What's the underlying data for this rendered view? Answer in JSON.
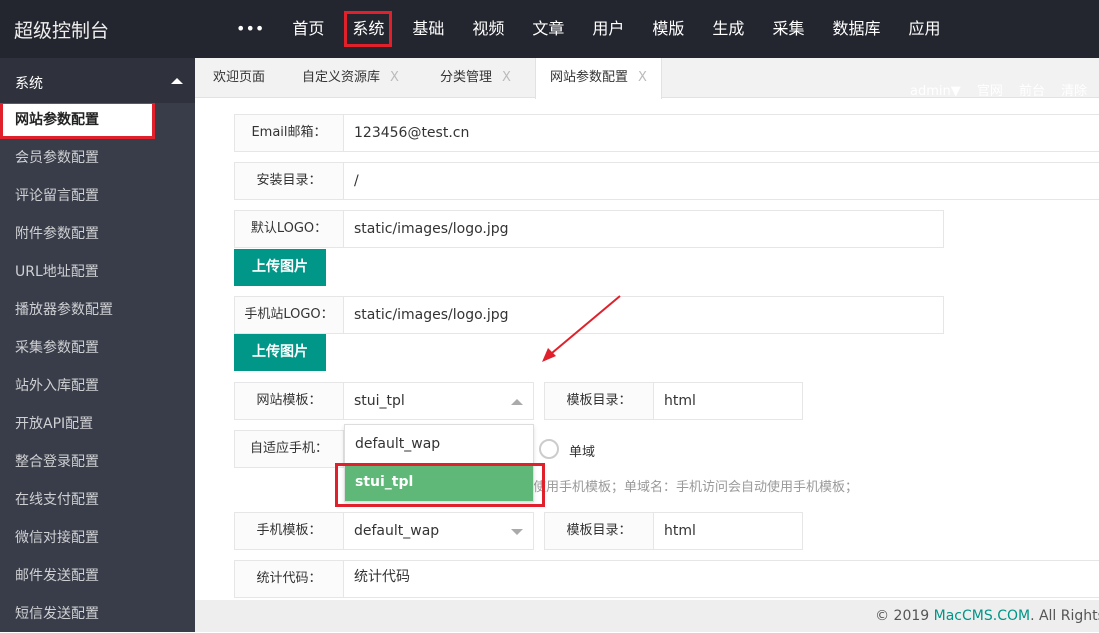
{
  "header": {
    "title": "超级控制台",
    "more": "•••",
    "nav": [
      "首页",
      "系统",
      "基础",
      "视频",
      "文章",
      "用户",
      "模版",
      "生成",
      "采集",
      "数据库",
      "应用"
    ],
    "active": "系统"
  },
  "sidebar": {
    "section": "系统",
    "items": [
      "网站参数配置",
      "会员参数配置",
      "评论留言配置",
      "附件参数配置",
      "URL地址配置",
      "播放器参数配置",
      "采集参数配置",
      "站外入库配置",
      "开放API配置",
      "整合登录配置",
      "在线支付配置",
      "微信对接配置",
      "邮件发送配置",
      "短信发送配置"
    ]
  },
  "tabs": [
    {
      "label": "欢迎页面"
    },
    {
      "label": "自定义资源库",
      "close": "X"
    },
    {
      "label": "分类管理",
      "close": "X"
    },
    {
      "label": "网站参数配置",
      "close": "X"
    }
  ],
  "top_links": "admin▼ 官网 前台 清除",
  "form": {
    "email": {
      "label": "Email邮箱：",
      "value": "123456@test.cn"
    },
    "install": {
      "label": "安装目录：",
      "value": "/"
    },
    "logo": {
      "label": "默认LOGO：",
      "value": "static/images/logo.jpg"
    },
    "upload": "上传图片",
    "mlogo": {
      "label": "手机站LOGO：",
      "value": "static/images/logo.jpg"
    },
    "template": {
      "label": "网站模板：",
      "value": "stui_tpl",
      "options": [
        "default_wap",
        "stui_tpl"
      ]
    },
    "tpl_dir": {
      "label": "模板目录：",
      "value": "html"
    },
    "adaptive": {
      "label": "自适应手机：",
      "radio": "单域",
      "tip": "使用手机模板；单域名：手机访问会自动使用手机模板；"
    },
    "mtemplate": {
      "label": "手机模板：",
      "value": "default_wap"
    },
    "mtpl_dir": {
      "label": "模板目录：",
      "value": "html"
    },
    "stat": {
      "label": "统计代码：",
      "value": "统计代码"
    }
  },
  "footer": {
    "pre": "© 2019 ",
    "link": "MacCMS.COM",
    "post": ". All Rights Reserved."
  },
  "colors": {
    "accent": "#009688",
    "selected": "#5fb878",
    "highlight": "#e0202a"
  }
}
